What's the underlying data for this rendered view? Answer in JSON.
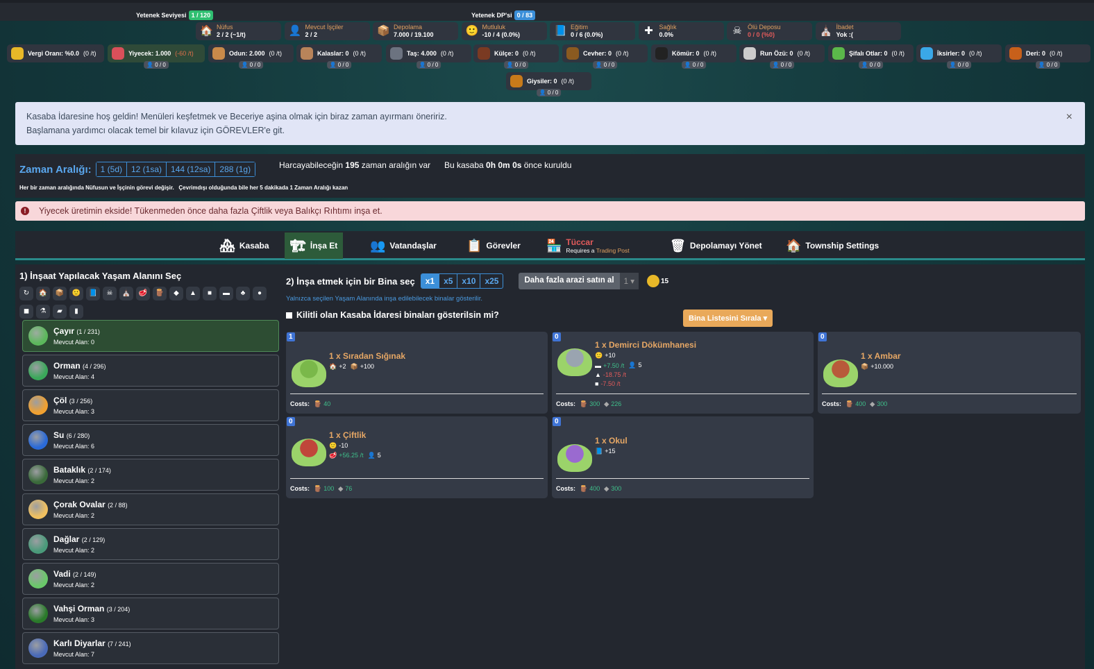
{
  "topbar": {
    "skill_level_label": "Yetenek Seviyesi",
    "skill_level": "1 / 120",
    "skill_dp_label": "Yetenek DP'si",
    "skill_dp": "0 / 83"
  },
  "stats": [
    {
      "icon": "house-icon",
      "glyph": "🏠",
      "title": "Nüfus",
      "value": "2 / 2  (~1/t)"
    },
    {
      "icon": "worker-icon",
      "glyph": "👤",
      "title": "Mevcut İşçiler",
      "value": "2 / 2"
    },
    {
      "icon": "storage-icon",
      "glyph": "📦",
      "title": "Depolama",
      "value": "7.000 / 19.100"
    },
    {
      "icon": "smiley-icon",
      "glyph": "🙂",
      "title": "Mutluluk",
      "value": "-10 / 4  (0.0%)"
    },
    {
      "icon": "book-icon",
      "glyph": "📘",
      "title": "Eğitim",
      "value": "0 / 6  (0.0%)"
    },
    {
      "icon": "health-icon",
      "glyph": "✚",
      "title": "Sağlık",
      "value": "0.0%"
    },
    {
      "icon": "skull-icon",
      "glyph": "☠",
      "title": "Ölü Deposu",
      "value": "0 / 0 (%0)",
      "danger": true
    },
    {
      "icon": "church-icon",
      "glyph": "⛪",
      "title": "İbadet",
      "value": "Yok :("
    }
  ],
  "resources": [
    {
      "icon": "coins-icon",
      "color": "#e8b828",
      "label": "Vergi Oranı: %0.0",
      "rate": "(0 /t)"
    },
    {
      "icon": "meat-icon",
      "color": "#d9505a",
      "label": "Yiyecek: 1.000",
      "rate": "(-60 /t)",
      "negative": true,
      "workers": "0 / 0"
    },
    {
      "icon": "wood-icon",
      "color": "#c88a4a",
      "label": "Odun: 2.000",
      "rate": "(0 /t)",
      "workers": "0 / 0"
    },
    {
      "icon": "plank-icon",
      "color": "#b8845a",
      "label": "Kalaslar: 0",
      "rate": "(0 /t)",
      "workers": "0 / 0"
    },
    {
      "icon": "stone-icon",
      "color": "#6c7380",
      "label": "Taş: 4.000",
      "rate": "(0 /t)",
      "workers": "0 / 0"
    },
    {
      "icon": "ingot-icon",
      "color": "#7a3a22",
      "label": "Külçe: 0",
      "rate": "(0 /t)",
      "workers": "0 / 0"
    },
    {
      "icon": "ore-icon",
      "color": "#8a5a20",
      "label": "Cevher: 0",
      "rate": "(0 /t)",
      "workers": "0 / 0"
    },
    {
      "icon": "coal-icon",
      "color": "#222",
      "label": "Kömür: 0",
      "rate": "(0 /t)",
      "workers": "0 / 0"
    },
    {
      "icon": "rune-icon",
      "color": "#ccc",
      "label": "Run Özü: 0",
      "rate": "(0 /t)",
      "workers": "0 / 0"
    },
    {
      "icon": "herb-icon",
      "color": "#5bb84a",
      "label": "Şifalı Otlar: 0",
      "rate": "(0 /t)",
      "workers": "0 / 0"
    },
    {
      "icon": "potion-icon",
      "color": "#3aa8e8",
      "label": "İksirler: 0",
      "rate": "(0 /t)",
      "workers": "0 / 0"
    },
    {
      "icon": "leather-icon",
      "color": "#c8601a",
      "label": "Deri: 0",
      "rate": "(0 /t)",
      "workers": "0 / 0"
    },
    {
      "icon": "clothes-icon",
      "color": "#c87a1a",
      "label": "Giysiler: 0",
      "rate": "(0 /t)",
      "workers": "0 / 0"
    }
  ],
  "welcome": {
    "line1": "Kasaba İdaresine hoş geldin! Menüleri keşfetmek ve Beceriye aşina olmak için biraz zaman ayırmanı öneririz.",
    "line2": "Başlamana yardımcı olacak temel bir kılavuz için GÖREVLER'e git.",
    "close": "×"
  },
  "time": {
    "label": "Zaman Aralığı:",
    "buttons": [
      "1 (5d)",
      "12 (1sa)",
      "144 (12sa)",
      "288 (1g)"
    ],
    "spend_pre": "Harcayabileceğin ",
    "spend_num": "195",
    "spend_post": " zaman aralığın var",
    "founded_pre": "Bu kasaba ",
    "founded_val": "0h 0m 0s",
    "founded_post": " önce kuruldu",
    "note": "Her bir zaman aralığında Nüfusun ve İşçinin görevi değişir.   Çevrimdışı olduğunda bile her 5 dakikada 1 Zaman Aralığı kazan"
  },
  "danger": {
    "text": "Yiyecek üretimin ekside! Tükenmeden önce daha fazla Çiftlik veya Balıkçı Rıhtımı inşa et."
  },
  "nav": {
    "tabs": [
      {
        "label": "Kasaba",
        "glyph": "🏘"
      },
      {
        "label": "İnşa Et",
        "glyph": "🏗",
        "active": true
      },
      {
        "label": "Vatandaşlar",
        "glyph": "👥"
      },
      {
        "label": "Görevler",
        "glyph": "📋"
      },
      {
        "label": "Tüccar",
        "glyph": "🏪",
        "sub_pre": "Requires a ",
        "sub_link": "Trading Post",
        "disabled": true
      },
      {
        "label": "Depolamayı Yönet",
        "glyph": "🗑"
      },
      {
        "label": "Township Settings",
        "glyph": "🏠"
      }
    ]
  },
  "left": {
    "title": "1) İnşaat Yapılacak Yaşam Alanını Seç",
    "filters": [
      "↻",
      "🏠",
      "📦",
      "🙂",
      "📘",
      "☠",
      "⛪",
      "🥩",
      "🪵",
      "◆",
      "▲",
      "■",
      "▬",
      "♣",
      "●",
      "◼",
      "⚗",
      "▰",
      "▮"
    ],
    "habitats": [
      {
        "name": "Çayır",
        "count": "(1 / 231)",
        "avail": "Mevcut Alan: 0",
        "color": "#5cb85c",
        "selected": true
      },
      {
        "name": "Orman",
        "count": "(4 / 296)",
        "avail": "Mevcut Alan: 4",
        "color": "#3aa85a"
      },
      {
        "name": "Çöl",
        "count": "(3 / 256)",
        "avail": "Mevcut Alan: 3",
        "color": "#f0a030"
      },
      {
        "name": "Su",
        "count": "(6 / 280)",
        "avail": "Mevcut Alan: 6",
        "color": "#2a6ad8"
      },
      {
        "name": "Bataklık",
        "count": "(2 / 174)",
        "avail": "Mevcut Alan: 2",
        "color": "#3a6a3a"
      },
      {
        "name": "Çorak Ovalar",
        "count": "(2 / 88)",
        "avail": "Mevcut Alan: 2",
        "color": "#f0c060"
      },
      {
        "name": "Dağlar",
        "count": "(2 / 129)",
        "avail": "Mevcut Alan: 2",
        "color": "#4a9a7a"
      },
      {
        "name": "Vadi",
        "count": "(2 / 149)",
        "avail": "Mevcut Alan: 2",
        "color": "#6ac86a"
      },
      {
        "name": "Vahşi Orman",
        "count": "(3 / 204)",
        "avail": "Mevcut Alan: 3",
        "color": "#2a7a2a"
      },
      {
        "name": "Karlı Diyarlar",
        "count": "(7 / 241)",
        "avail": "Mevcut Alan: 7",
        "color": "#4a6ab8"
      }
    ]
  },
  "right": {
    "title": "2) İnşa etmek için bir Bina seç",
    "multipliers": [
      "x1",
      "x5",
      "x10",
      "x25"
    ],
    "buy_land": "Daha fazla arazi satın al",
    "buy_qty": "1",
    "coins": "15",
    "hint": "Yalnızca seçilen Yaşam Alanında inşa edilebilecek binalar gösterilir.",
    "locked_label": "Kilitli olan Kasaba İdaresi binaları gösterilsin mi?",
    "sort": "Bina Listesini Sırala",
    "costs_label": "Costs:",
    "buildings": [
      {
        "count": "1",
        "name": "1 x Sıradan Sığınak",
        "effects": [
          [
            {
              "g": "🏠",
              "t": "+2"
            },
            {
              "g": "📦",
              "t": "+100"
            }
          ]
        ],
        "costs": [
          {
            "g": "🪵",
            "t": "40"
          }
        ]
      },
      {
        "count": "0",
        "name": "1 x Demirci Dökümhanesi",
        "effects": [
          [
            {
              "g": "🙂",
              "t": "+10"
            }
          ],
          [
            {
              "g": "▬",
              "t": "+7.50 /t",
              "c": "g"
            },
            {
              "g": "👤",
              "t": "5"
            }
          ],
          [
            {
              "g": "▲",
              "t": "-18.75 /t",
              "c": "r"
            }
          ],
          [
            {
              "g": "■",
              "t": "-7.50 /t",
              "c": "r"
            }
          ]
        ],
        "costs": [
          {
            "g": "🪵",
            "t": "300"
          },
          {
            "g": "◆",
            "t": "226"
          }
        ]
      },
      {
        "count": "0",
        "name": "1 x Ambar",
        "effects": [
          [
            {
              "g": "📦",
              "t": "+10.000"
            }
          ]
        ],
        "costs": [
          {
            "g": "🪵",
            "t": "400"
          },
          {
            "g": "◆",
            "t": "300"
          }
        ]
      },
      {
        "count": "0",
        "name": "1 x Çiftlik",
        "effects": [
          [
            {
              "g": "🙂",
              "t": "-10"
            }
          ],
          [
            {
              "g": "🥩",
              "t": "+56.25 /t",
              "c": "g"
            },
            {
              "g": "👤",
              "t": "5"
            }
          ]
        ],
        "costs": [
          {
            "g": "🪵",
            "t": "100"
          },
          {
            "g": "◆",
            "t": "76"
          }
        ]
      },
      {
        "count": "0",
        "name": "1 x Okul",
        "effects": [
          [
            {
              "g": "📘",
              "t": "+15"
            }
          ]
        ],
        "costs": [
          {
            "g": "🪵",
            "t": "400"
          },
          {
            "g": "◆",
            "t": "300"
          }
        ]
      }
    ]
  },
  "colors": {
    "accent": "#3b8fd9",
    "green_badge": "#2fbf71",
    "building_name": "#e6a765",
    "sort_button": "#e9a95a"
  }
}
